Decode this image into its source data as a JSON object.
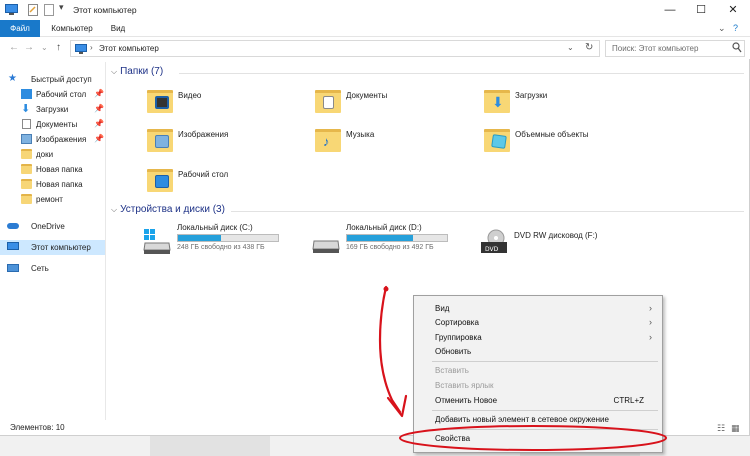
{
  "window": {
    "title": "Этот компьютер",
    "controls": [
      "—",
      "☐",
      "✕"
    ]
  },
  "ribbon": {
    "tabs": [
      "Файл",
      "Компьютер",
      "Вид"
    ]
  },
  "address": {
    "path": "Этот компьютер",
    "search_placeholder": "Поиск: Этот компьютер"
  },
  "sidebar": {
    "items": [
      {
        "label": "Быстрый доступ",
        "icon": "star-icon"
      },
      {
        "label": "Рабочий стол",
        "icon": "desktop-folder-icon",
        "pinned": true
      },
      {
        "label": "Загрузки",
        "icon": "download-icon",
        "pinned": true
      },
      {
        "label": "Документы",
        "icon": "documents-icon",
        "pinned": true
      },
      {
        "label": "Изображения",
        "icon": "pictures-icon",
        "pinned": true
      },
      {
        "label": "доки",
        "icon": "folder-icon"
      },
      {
        "label": "Новая папка",
        "icon": "folder-icon"
      },
      {
        "label": "Новая папка",
        "icon": "folder-icon"
      },
      {
        "label": "ремонт",
        "icon": "folder-icon"
      },
      {
        "label": "OneDrive",
        "icon": "cloud-icon"
      },
      {
        "label": "Этот компьютер",
        "icon": "computer-icon",
        "selected": true
      },
      {
        "label": "Сеть",
        "icon": "network-icon"
      }
    ]
  },
  "folders": {
    "header": "Папки (7)",
    "items": [
      {
        "label": "Видео",
        "icon": "video-folder-icon"
      },
      {
        "label": "Документы",
        "icon": "documents-folder-icon"
      },
      {
        "label": "Загрузки",
        "icon": "downloads-folder-icon"
      },
      {
        "label": "Изображения",
        "icon": "pictures-folder-icon"
      },
      {
        "label": "Музыка",
        "icon": "music-folder-icon"
      },
      {
        "label": "Объемные объекты",
        "icon": "3d-objects-folder-icon"
      },
      {
        "label": "Рабочий стол",
        "icon": "desktop-folder-icon"
      }
    ]
  },
  "devices": {
    "header": "Устройства и диски (3)",
    "items": [
      {
        "label": "Локальный диск (C:)",
        "free": "248 ГБ свободно из 438 ГБ",
        "used_fraction": 0.43,
        "icon": "windows-drive-icon"
      },
      {
        "label": "Локальный диск (D:)",
        "free": "169 ГБ свободно из 492 ГБ",
        "used_fraction": 0.66,
        "icon": "hard-drive-icon"
      },
      {
        "label": "DVD RW дисковод (F:)",
        "icon": "dvd-drive-icon"
      }
    ]
  },
  "context_menu": {
    "items": [
      {
        "label": "Вид",
        "submenu": true
      },
      {
        "label": "Сортировка",
        "submenu": true
      },
      {
        "label": "Группировка",
        "submenu": true
      },
      {
        "label": "Обновить"
      },
      {
        "label": "Вставить",
        "disabled": true
      },
      {
        "label": "Вставить ярлык",
        "disabled": true
      },
      {
        "label": "Отменить Новое",
        "shortcut": "CTRL+Z"
      },
      {
        "label": "Добавить новый элемент в сетевое окружение"
      },
      {
        "label": "Свойства"
      }
    ]
  },
  "status": {
    "count": "Элементов: 10"
  },
  "colors": {
    "accent": "#1979ca",
    "drive_bar": "#26a0da",
    "annotation": "#d8121b",
    "selection": "#cde8ff"
  }
}
